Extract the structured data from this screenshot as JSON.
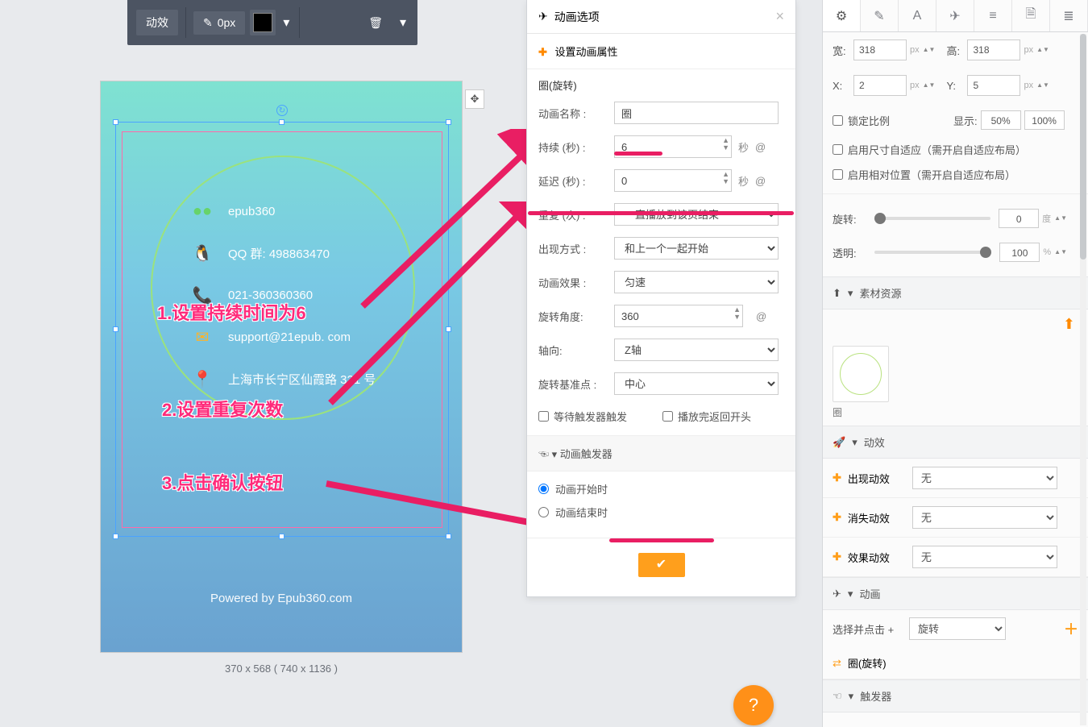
{
  "toolbar": {
    "btn_effect": "动效",
    "px_value": "0px"
  },
  "canvas": {
    "size_label": "370 x 568 ( 740 x 1136 )",
    "contacts": [
      {
        "icon": "wechat-icon",
        "color": "#67d36a",
        "text": "epub360"
      },
      {
        "icon": "qq-icon",
        "color": "#222",
        "text": "QQ 群:  498863470"
      },
      {
        "icon": "phone-icon",
        "color": "#ff7a2a",
        "text": "021-360360360"
      },
      {
        "icon": "email-icon",
        "color": "#ffb327",
        "text": "support@21epub. com"
      },
      {
        "icon": "location-icon",
        "color": "#ff3a3a",
        "text": "上海市长宁区仙霞路 321 号"
      }
    ],
    "powered": "Powered by Epub360.com",
    "anno1": "1.设置持续时间为6",
    "anno2": "2.设置重复次数",
    "anno3": "3.点击确认按钮"
  },
  "panel": {
    "header": "动画选项",
    "set_prop": "设置动画属性",
    "title": "圈(旋转)",
    "name_label": "动画名称 :",
    "name_value": "圈",
    "duration_label": "持续 (秒)  :",
    "duration_value": "6",
    "duration_unit": "秒",
    "delay_label": "延迟 (秒)  :",
    "delay_value": "0",
    "delay_unit": "秒",
    "repeat_label": "重复 (次)  :",
    "repeat_value": "一直播放到该页结束",
    "appear_label": "出现方式 :",
    "appear_value": "和上一个一起开始",
    "effect_label": "动画效果 :",
    "effect_value": "匀速",
    "angle_label": "旋转角度:",
    "angle_value": "360",
    "axis_label": "轴向:",
    "axis_value": "Z轴",
    "base_label": "旋转基准点 :",
    "base_value": "中心",
    "ck_wait": "等待触发器触发",
    "ck_rewind": "播放完返回开头",
    "trigger_section": "动画触发器",
    "radio_start": "动画开始时",
    "radio_end": "动画结束时",
    "at": "@"
  },
  "right": {
    "w_label": "宽:",
    "width": "318",
    "h_label": "高:",
    "height": "318",
    "x_label": "X:",
    "x": "2",
    "y_label": "Y:",
    "y": "5",
    "px": "px",
    "lock": "锁定比例",
    "show_label": "显示:",
    "show50": "50%",
    "show100": "100%",
    "auto_size": "启用尺寸自适应（需开启自适应布局）",
    "auto_pos": "启用相对位置（需开启自适应布局）",
    "rotate_label": "旋转:",
    "rotate_val": "0",
    "rotate_unit": "度",
    "opacity_label": "透明:",
    "opacity_val": "100",
    "opacity_unit": "%",
    "assets_section": "素材资源",
    "thumb_name": "圈",
    "fx_section": "动效",
    "fx_appear": "出现动效",
    "fx_disappear": "消失动效",
    "fx_effect": "效果动效",
    "fx_none": "无",
    "anim_section": "动画",
    "anim_select_label": "选择并点击 +",
    "anim_select_value": "旋转",
    "anim_item": "圈(旋转)",
    "trigger_section": "触发器"
  },
  "fab": "?"
}
